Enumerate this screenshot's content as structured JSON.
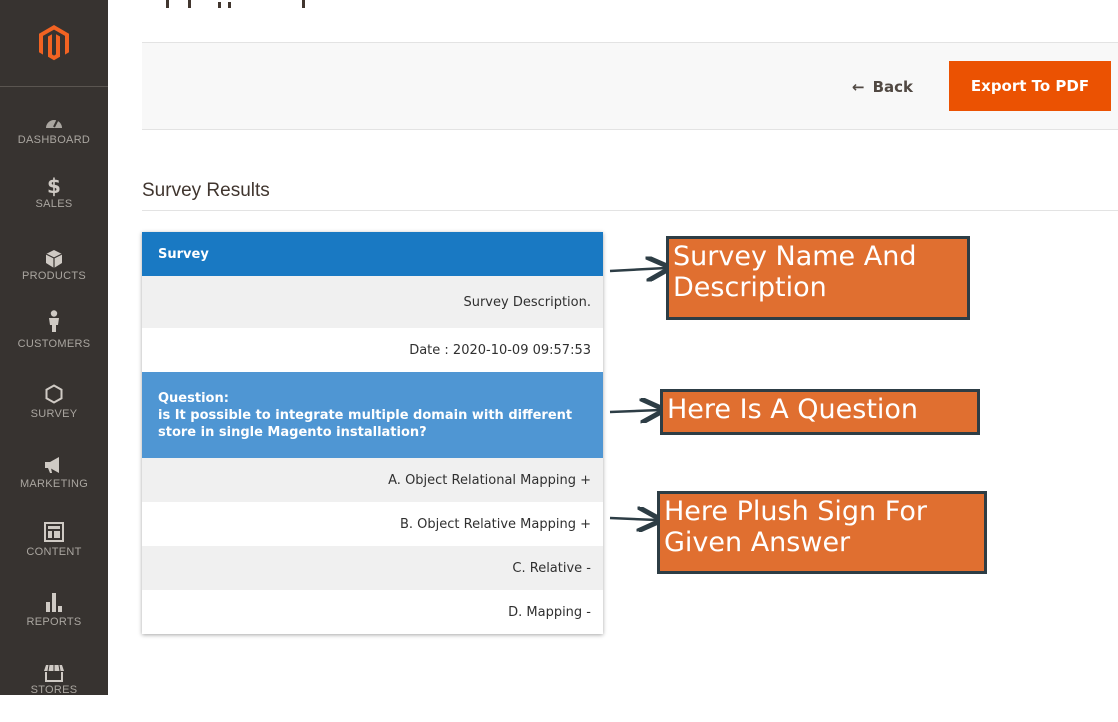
{
  "sidebar": {
    "items": [
      {
        "label": "DASHBOARD",
        "icon": "dashboard-icon"
      },
      {
        "label": "SALES",
        "icon": "dollar-icon"
      },
      {
        "label": "PRODUCTS",
        "icon": "box-icon"
      },
      {
        "label": "CUSTOMERS",
        "icon": "person-icon"
      },
      {
        "label": "SURVEY",
        "icon": "hexagon-icon"
      },
      {
        "label": "MARKETING",
        "icon": "megaphone-icon"
      },
      {
        "label": "CONTENT",
        "icon": "layout-icon"
      },
      {
        "label": "REPORTS",
        "icon": "bar-chart-icon"
      },
      {
        "label": "STORES",
        "icon": "store-icon"
      }
    ]
  },
  "toolbar": {
    "back_label": "Back",
    "back_arrow": "←",
    "export_label": "Export To PDF"
  },
  "section": {
    "title": "Survey Results"
  },
  "survey": {
    "header": "Survey",
    "description": "Survey Description.",
    "date": "Date : 2020-10-09 09:57:53",
    "question_label": "Question:",
    "question_text": "is It possible to integrate multiple domain with different store in single Magento installation?",
    "answers": [
      "A. Object Relational Mapping +",
      "B. Object Relative Mapping +",
      "C. Relative -",
      "D. Mapping -"
    ]
  },
  "annotations": {
    "survey_name": "Survey Name And Description",
    "question": "Here Is A Question",
    "plus_sign": "Here Plush Sign For Given Answer"
  },
  "colors": {
    "sidebar_bg": "#373330",
    "brand_orange": "#eb5202",
    "header_blue": "#1979c3",
    "question_blue": "#4f96d3",
    "callout_bg": "#e06f30",
    "callout_border": "#2d3d45"
  }
}
